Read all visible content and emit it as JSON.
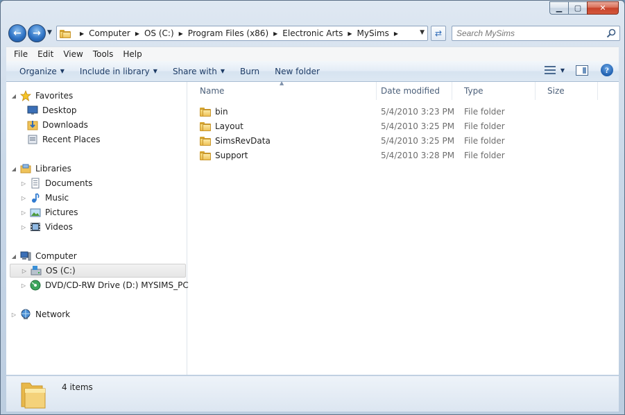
{
  "window": {
    "caption_min": "▁",
    "caption_max": "▢",
    "caption_close": "✕"
  },
  "address": {
    "crumbs": [
      "Computer",
      "OS (C:)",
      "Program Files (x86)",
      "Electronic Arts",
      "MySims"
    ],
    "search_placeholder": "Search MySims"
  },
  "menubar": {
    "items": [
      "File",
      "Edit",
      "View",
      "Tools",
      "Help"
    ]
  },
  "commandbar": {
    "organize": "Organize",
    "include_in_library": "Include in library",
    "share_with": "Share with",
    "burn": "Burn",
    "new_folder": "New folder"
  },
  "navigation": {
    "favorites": {
      "label": "Favorites",
      "items": [
        "Desktop",
        "Downloads",
        "Recent Places"
      ]
    },
    "libraries": {
      "label": "Libraries",
      "items": [
        "Documents",
        "Music",
        "Pictures",
        "Videos"
      ]
    },
    "computer": {
      "label": "Computer",
      "items": [
        "OS (C:)",
        "DVD/CD-RW Drive (D:) MYSIMS_PC"
      ],
      "selected": "OS (C:)"
    },
    "network": {
      "label": "Network"
    }
  },
  "columns": {
    "name": "Name",
    "date_modified": "Date modified",
    "type": "Type",
    "size": "Size"
  },
  "files": [
    {
      "name": "bin",
      "date": "5/4/2010 3:23 PM",
      "type": "File folder"
    },
    {
      "name": "Layout",
      "date": "5/4/2010 3:25 PM",
      "type": "File folder"
    },
    {
      "name": "SimsRevData",
      "date": "5/4/2010 3:25 PM",
      "type": "File folder"
    },
    {
      "name": "Support",
      "date": "5/4/2010 3:28 PM",
      "type": "File folder"
    }
  ],
  "status": {
    "item_count": "4 items"
  },
  "colors": {
    "accent": "#1e3c66",
    "folder": "#efc35a",
    "secondary_text": "#6d6d6d"
  }
}
